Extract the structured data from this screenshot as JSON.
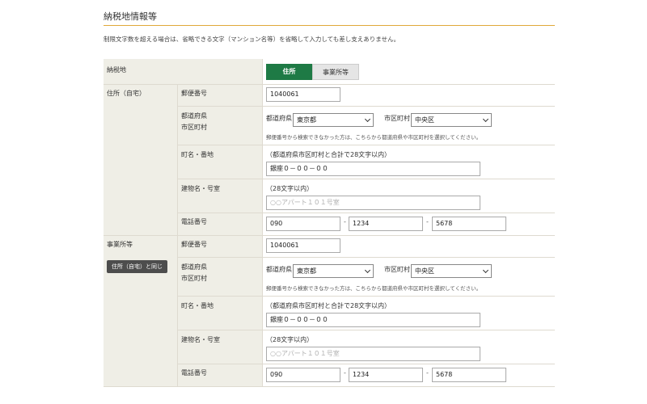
{
  "section_title": "納税地情報等",
  "notice": "制限文字数を超える場合は、省略できる文字（マンション名等）を省略して入力しても差し支えありません。",
  "nozeichi": {
    "label": "納税地",
    "tabs": [
      "住所",
      "事業所等"
    ],
    "active_tab": "住所"
  },
  "home": {
    "group_label": "住所（自宅）",
    "postal_label": "郵便番号",
    "postal_value": "1040061",
    "pref_city_label_1": "都道府県",
    "pref_city_label_2": "市区町村",
    "pref_inline_label": "都道府県",
    "pref_value": "東京都",
    "city_inline_label": "市区町村",
    "city_value": "中央区",
    "pref_hint": "郵便番号から検索できなかった方は、こちらから都道府県や市区町村を選択してください。",
    "town_label": "町名・番地",
    "town_note": "（都道府県市区町村と合計で28文字以内）",
    "town_value": "銀座０－００－００",
    "building_label": "建物名・号室",
    "building_note": "（28文字以内）",
    "building_placeholder": "○○アパート１０１号室",
    "phone_label": "電話番号",
    "phone_1": "090",
    "phone_2": "1234",
    "phone_3": "5678"
  },
  "office": {
    "group_label": "事業所等",
    "same_button": "住所（自宅）と同じ",
    "postal_label": "郵便番号",
    "postal_value": "1040061",
    "pref_city_label_1": "都道府県",
    "pref_city_label_2": "市区町村",
    "pref_inline_label": "都道府県",
    "pref_value": "東京都",
    "city_inline_label": "市区町村",
    "city_value": "中央区",
    "pref_hint": "郵便番号から検索できなかった方は、こちらから都道府県や市区町村を選択してください。",
    "town_label": "町名・番地",
    "town_note": "（都道府県市区町村と合計で28文字以内）",
    "town_value": "銀座０－００－００",
    "building_label": "建物名・号室",
    "building_note": "（28文字以内）",
    "building_placeholder": "○○アパート１０１号室",
    "phone_label": "電話番号",
    "phone_1": "090",
    "phone_2": "1234",
    "phone_3": "5678"
  },
  "colors": {
    "accent_green": "#1e7a45",
    "header_rule": "#e0a93a",
    "label_bg": "#efeee6"
  }
}
